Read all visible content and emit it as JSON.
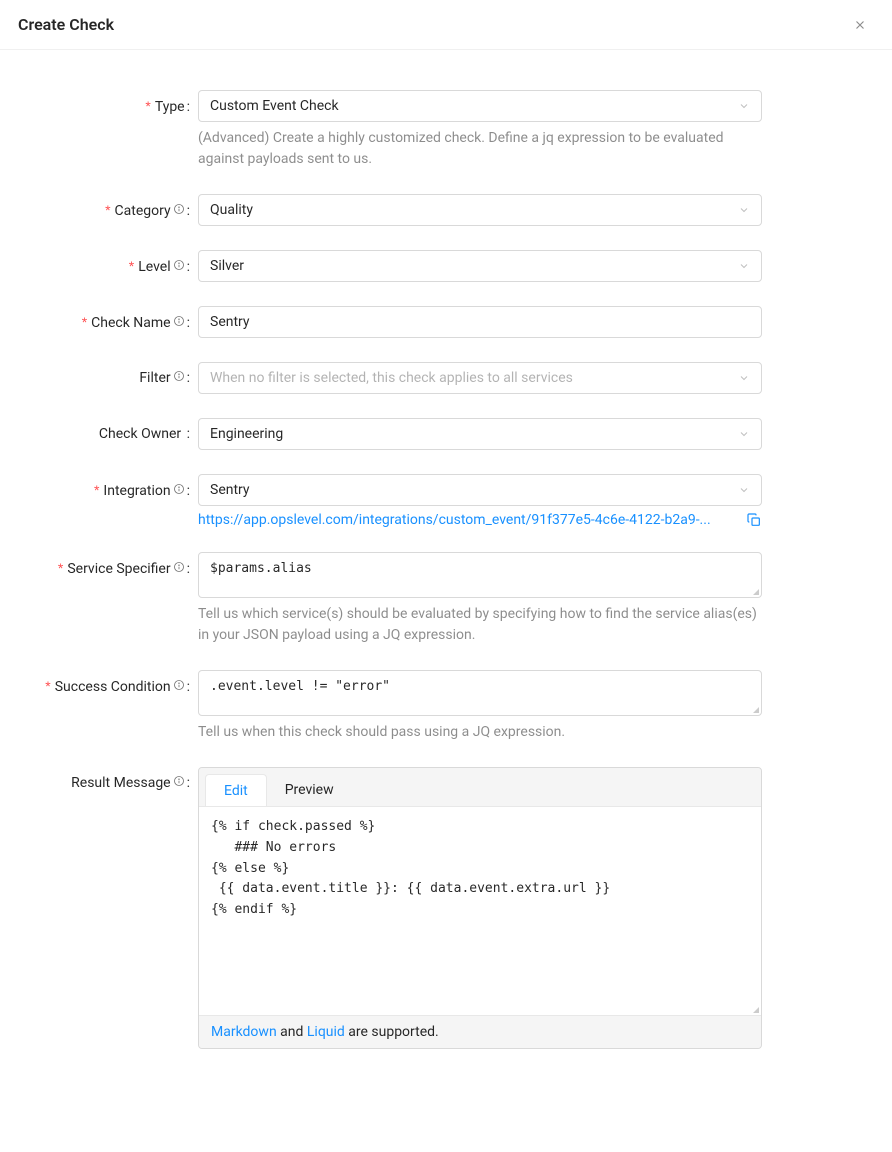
{
  "header": {
    "title": "Create Check"
  },
  "form": {
    "type": {
      "label": "Type",
      "value": "Custom Event Check",
      "help": "(Advanced) Create a highly customized check. Define a jq expression to be evaluated against payloads sent to us."
    },
    "category": {
      "label": "Category",
      "value": "Quality"
    },
    "level": {
      "label": "Level",
      "value": "Silver"
    },
    "check_name": {
      "label": "Check Name",
      "value": "Sentry"
    },
    "filter": {
      "label": "Filter",
      "placeholder": "When no filter is selected, this check applies to all services"
    },
    "check_owner": {
      "label": "Check Owner",
      "value": "Engineering"
    },
    "integration": {
      "label": "Integration",
      "value": "Sentry",
      "url": "https://app.opslevel.com/integrations/custom_event/91f377e5-4c6e-4122-b2a9-..."
    },
    "service_specifier": {
      "label": "Service Specifier",
      "value": "$params.alias",
      "help": "Tell us which service(s) should be evaluated by specifying how to find the service alias(es) in your JSON payload using a JQ expression."
    },
    "success_condition": {
      "label": "Success Condition",
      "value": ".event.level != \"error\"",
      "help": "Tell us when this check should pass using a JQ expression."
    },
    "result_message": {
      "label": "Result Message",
      "tabs": {
        "edit": "Edit",
        "preview": "Preview"
      },
      "body": "{% if check.passed %}\n   ### No errors\n{% else %}\n {{ data.event.title }}: {{ data.event.extra.url }}\n{% endif %}",
      "footer": {
        "markdown_link": "Markdown",
        "and_text": " and ",
        "liquid_link": "Liquid",
        "suffix": " are supported."
      }
    }
  }
}
